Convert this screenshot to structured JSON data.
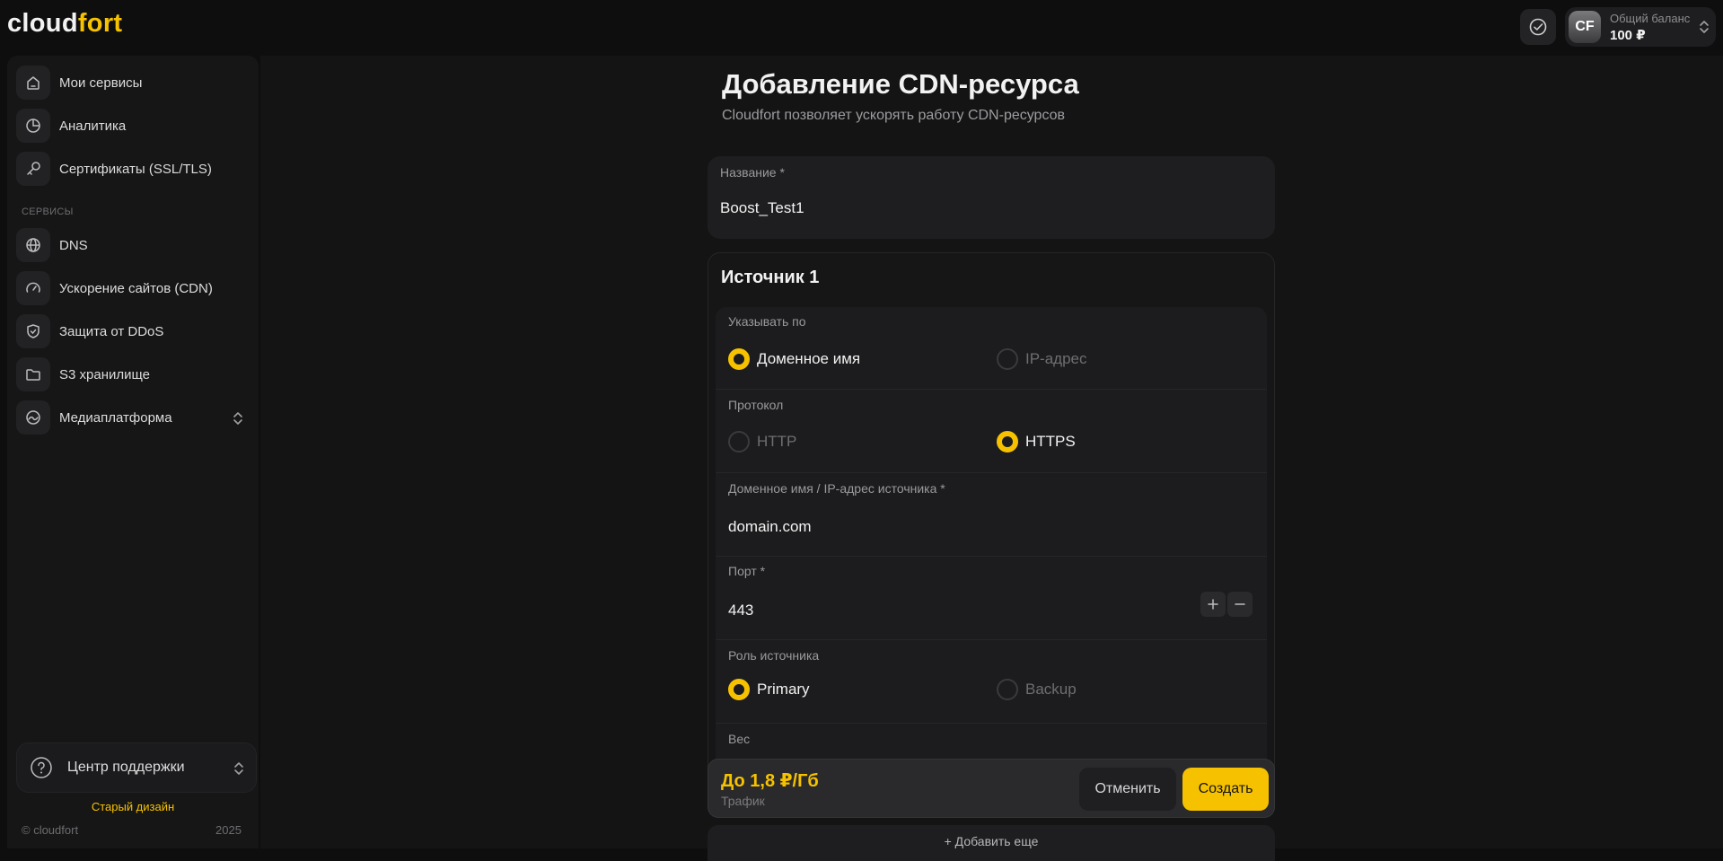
{
  "app": {
    "logo_part1": "cloud",
    "logo_part2": "fort",
    "accent_color": "#f6c200"
  },
  "account": {
    "avatar_initials": "CF",
    "balance_label": "Общий баланс",
    "balance_value": "100 ₽"
  },
  "sidebar": {
    "items": [
      {
        "label": "Мои сервисы",
        "icon": "home-icon"
      },
      {
        "label": "Аналитика",
        "icon": "pie-chart-icon"
      },
      {
        "label": "Сертификаты (SSL/TLS)",
        "icon": "key-icon"
      }
    ],
    "section_label": "СЕРВИСЫ",
    "services": [
      {
        "label": "DNS",
        "icon": "globe-icon"
      },
      {
        "label": "Ускорение сайтов (CDN)",
        "icon": "speedometer-icon"
      },
      {
        "label": "Защита от DDoS",
        "icon": "shield-icon"
      },
      {
        "label": "S3 хранилище",
        "icon": "folder-icon"
      },
      {
        "label": "Медиаплатформа",
        "icon": "media-icon"
      }
    ],
    "support_label": "Центр поддержки",
    "old_design_label": "Старый дизайн",
    "copyright": "© cloudfort",
    "year": "2025"
  },
  "page": {
    "title": "Добавление CDN-ресурса",
    "subtitle": "Cloudfort позволяет ускорять работу CDN-ресурсов"
  },
  "form": {
    "name_label": "Название *",
    "name_value": "Boost_Test1",
    "source_title": "Источник 1",
    "specify_by_label": "Указывать по",
    "specify_options": [
      {
        "label": "Доменное имя",
        "selected": true
      },
      {
        "label": "IP-адрес",
        "selected": false
      }
    ],
    "protocol_label": "Протокол",
    "protocol_options": [
      {
        "label": "HTTP",
        "selected": false
      },
      {
        "label": "HTTPS",
        "selected": true
      }
    ],
    "source_host_label": "Доменное имя / IP-адрес источника *",
    "source_host_value": "domain.com",
    "port_label": "Порт *",
    "port_value": "443",
    "role_label": "Роль источника",
    "role_options": [
      {
        "label": "Primary",
        "selected": true
      },
      {
        "label": "Backup",
        "selected": false
      }
    ],
    "weight_label": "Вес"
  },
  "footer_bar": {
    "price": "До 1,8 ₽/Гб",
    "price_caption": "Трафик",
    "cancel_label": "Отменить",
    "create_label": "Создать",
    "add_more_label": "+ Добавить еще"
  }
}
